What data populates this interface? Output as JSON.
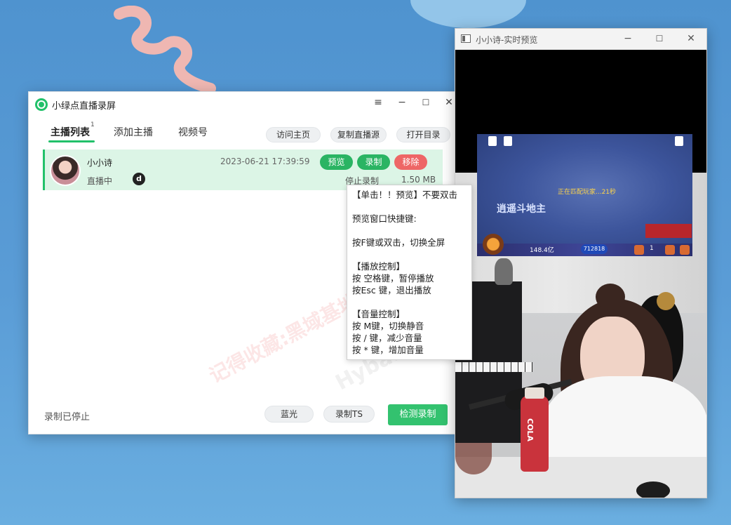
{
  "main_window": {
    "title": "小绿点直播录屏",
    "controls": {
      "menu": "≡",
      "minimize": "−",
      "maximize": "☐",
      "close": "✕"
    },
    "tabs": [
      {
        "label": "主播列表",
        "badge": "1",
        "active": true
      },
      {
        "label": "添加主播",
        "active": false
      },
      {
        "label": "视频号",
        "active": false
      }
    ],
    "actions": [
      "访问主页",
      "复制直播源",
      "打开目录"
    ],
    "streamer": {
      "name": "小小诗",
      "status": "直播中",
      "platform_icon": "d",
      "time": "2023-06-21 17:39:59",
      "record_status": "停止录制",
      "size": "1.50 MB",
      "buttons": {
        "preview": "预览",
        "record": "录制",
        "remove": "移除"
      }
    },
    "footer": {
      "status": "录制已停止",
      "bluray": "蓝光",
      "record_ts": "录制TS",
      "detect": "检测录制"
    },
    "watermark": "记得收藏:黑域基地",
    "watermark2": "Hyba.com"
  },
  "tooltip": {
    "lines": [
      "【单击！！预览】不要双击",
      "",
      "预览窗口快捷键:",
      "",
      "按F键或双击，切换全屏",
      "",
      "【播放控制】",
      "按 空格键，暂停播放",
      "按Esc 键，退出播放",
      "",
      "【音量控制】",
      "按 M键，切换静音",
      "按 / 键，减少音量",
      "按 * 键，增加音量"
    ]
  },
  "preview_window": {
    "title": "小小诗-实时预览",
    "controls": {
      "minimize": "−",
      "maximize": "☐",
      "close": "✕"
    },
    "game": {
      "matching_text": "正在匹配玩家...21秒",
      "logo": "逍遥斗地主",
      "money": "148.4亿",
      "gold": "712818",
      "level": "1"
    },
    "bottle_text": "COLA"
  },
  "colors": {
    "accent": "#22c16a",
    "record_btn": "#33c26f",
    "remove_btn": "#ee6666",
    "row_bg": "#dcf5e6"
  }
}
